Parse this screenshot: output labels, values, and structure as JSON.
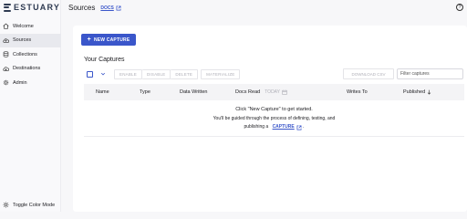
{
  "brand": {
    "name": "ESTUARY"
  },
  "sidebar": {
    "items": [
      {
        "label": "Welcome",
        "icon": "home-icon"
      },
      {
        "label": "Sources",
        "icon": "cloud-upload-icon",
        "active": true
      },
      {
        "label": "Collections",
        "icon": "database-icon"
      },
      {
        "label": "Destinations",
        "icon": "cloud-download-icon"
      },
      {
        "label": "Admin",
        "icon": "gear-icon"
      }
    ],
    "toggle_label": "Toggle Color Mode"
  },
  "header": {
    "title": "Sources",
    "docs_label": "DOCS"
  },
  "main": {
    "new_capture_label": "NEW CAPTURE",
    "section_title": "Your Captures",
    "toolbar": {
      "buttons": [
        "ENABLE",
        "DISABLE",
        "DELETE",
        "MATERIALIZE"
      ],
      "download_label": "DOWNLOAD CSV",
      "filter_placeholder": "Filter captures"
    },
    "table": {
      "columns": {
        "name": "Name",
        "type": "Type",
        "data_written": "Data Written",
        "docs_read": "Docs Read",
        "docs_read_range": "TODAY",
        "writes_to": "Writes To",
        "published": "Published"
      }
    },
    "empty_state": {
      "title": "Click \"New Capture\" to get started.",
      "line2": "You'll be guided through the process of defining, testing, and",
      "line3_prefix": "publishing a",
      "link": "CAPTURE",
      "line3_suffix": "."
    }
  },
  "colors": {
    "accent": "#3a56ca",
    "brand": "#2f3b52"
  }
}
